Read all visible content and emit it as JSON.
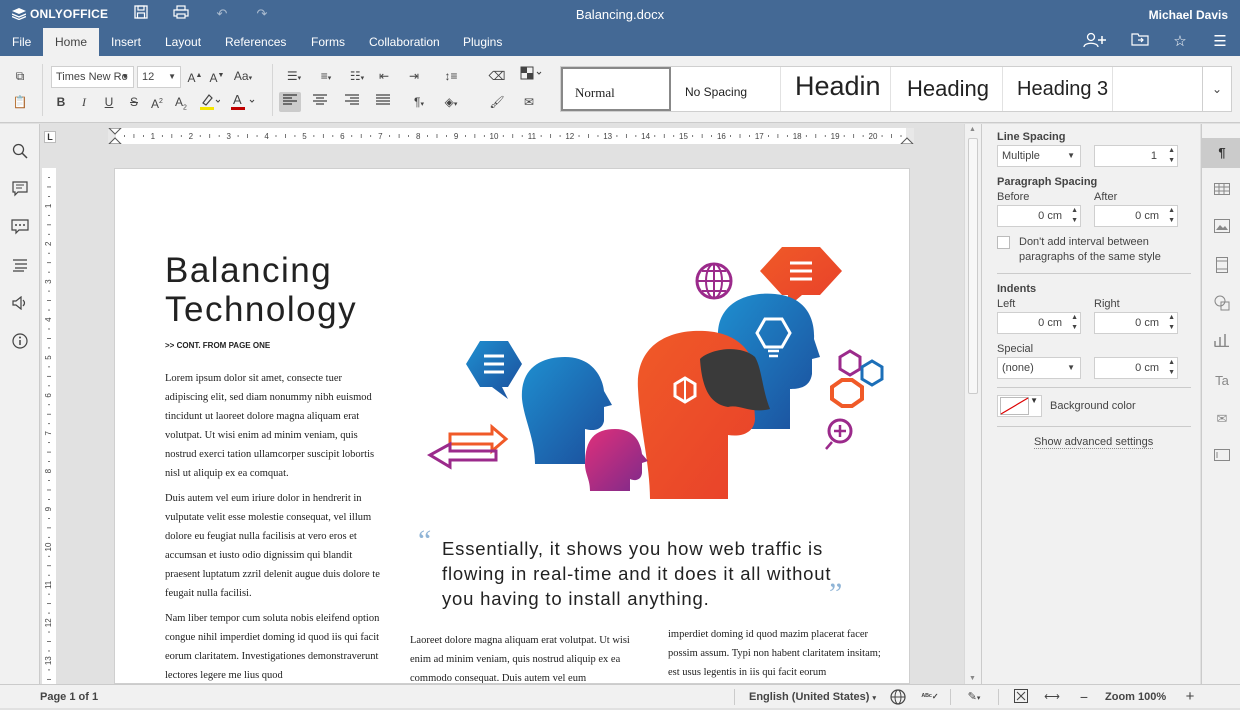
{
  "app": {
    "name": "ONLYOFFICE",
    "doc_title": "Balancing.docx",
    "user": "Michael Davis"
  },
  "menu": {
    "tabs": [
      "File",
      "Home",
      "Insert",
      "Layout",
      "References",
      "Forms",
      "Collaboration",
      "Plugins"
    ],
    "active": "Home"
  },
  "toolbar": {
    "font_name": "Times New Ro",
    "font_size": "12",
    "styles": [
      "Normal",
      "No Spacing",
      "Headin",
      "Heading",
      "Heading 3"
    ]
  },
  "document": {
    "title_line1": "Balancing",
    "title_line2": "Technology",
    "continued": ">> CONT. FROM PAGE ONE",
    "para1": "Lorem ipsum dolor sit amet, consecte tuer adipiscing elit, sed diam nonummy nibh euismod tincidunt ut laoreet dolore magna aliquam erat volutpat. Ut wisi enim ad minim veniam, quis nostrud exerci tation ullamcorper suscipit lobortis nisl ut aliquip ex ea comquat.",
    "para2": "Duis autem vel eum iriure dolor in hendrerit in vulputate velit esse molestie consequat, vel illum dolore eu feugiat nulla facilisis at vero eros et accumsan et iusto odio dignissim qui blandit praesent luptatum zzril delenit augue duis dolore te feugait nulla facilisi.",
    "para3": "Nam liber tempor cum soluta nobis eleifend option congue nihil imperdiet doming id quod iis qui facit eorum claritatem. Investigationes demonstraverunt lectores legere me lius quod",
    "quote": "Essentially, it shows you how web traffic is flowing in real-time and it does it all without you having to install anything.",
    "col2": "Laoreet dolore magna aliquam erat volutpat. Ut wisi enim ad minim veniam, quis nostrud aliquip ex ea commodo consequat. Duis autem vel eum",
    "col3": "imperdiet doming id quod mazim placerat facer possim assum. Typi non habent claritatem insitam; est usus legentis in iis qui facit eorum"
  },
  "right_panel": {
    "line_spacing_label": "Line Spacing",
    "line_spacing_mode": "Multiple",
    "line_spacing_value": "1",
    "para_spacing_label": "Paragraph Spacing",
    "before_label": "Before",
    "after_label": "After",
    "before_value": "0 cm",
    "after_value": "0 cm",
    "dont_add_interval": "Don't add interval between paragraphs of the same style",
    "indents_label": "Indents",
    "left_label": "Left",
    "right_label": "Right",
    "left_value": "0 cm",
    "right_value": "0 cm",
    "special_label": "Special",
    "special_value": "(none)",
    "special_amount": "0 cm",
    "bg_color_label": "Background color",
    "advanced": "Show advanced settings"
  },
  "statusbar": {
    "page": "Page 1 of 1",
    "language": "English (United States)",
    "zoom": "Zoom 100%"
  },
  "ruler": {
    "h_numbers": [
      "1",
      "2",
      "3",
      "4",
      "5",
      "6",
      "7",
      "8",
      "9",
      "10",
      "11",
      "12",
      "13",
      "14",
      "15",
      "16",
      "17",
      "18",
      "19",
      "20"
    ],
    "v_numbers": [
      "1",
      "2",
      "3",
      "4",
      "5",
      "6",
      "7",
      "8",
      "9",
      "10",
      "11",
      "12",
      "13"
    ]
  },
  "colors": {
    "brand": "#446995",
    "toolbar_bg": "#f1f1f1",
    "accent_orange": "#e8502a",
    "accent_blue": "#2a73b8",
    "accent_purple": "#9b2a8b"
  }
}
